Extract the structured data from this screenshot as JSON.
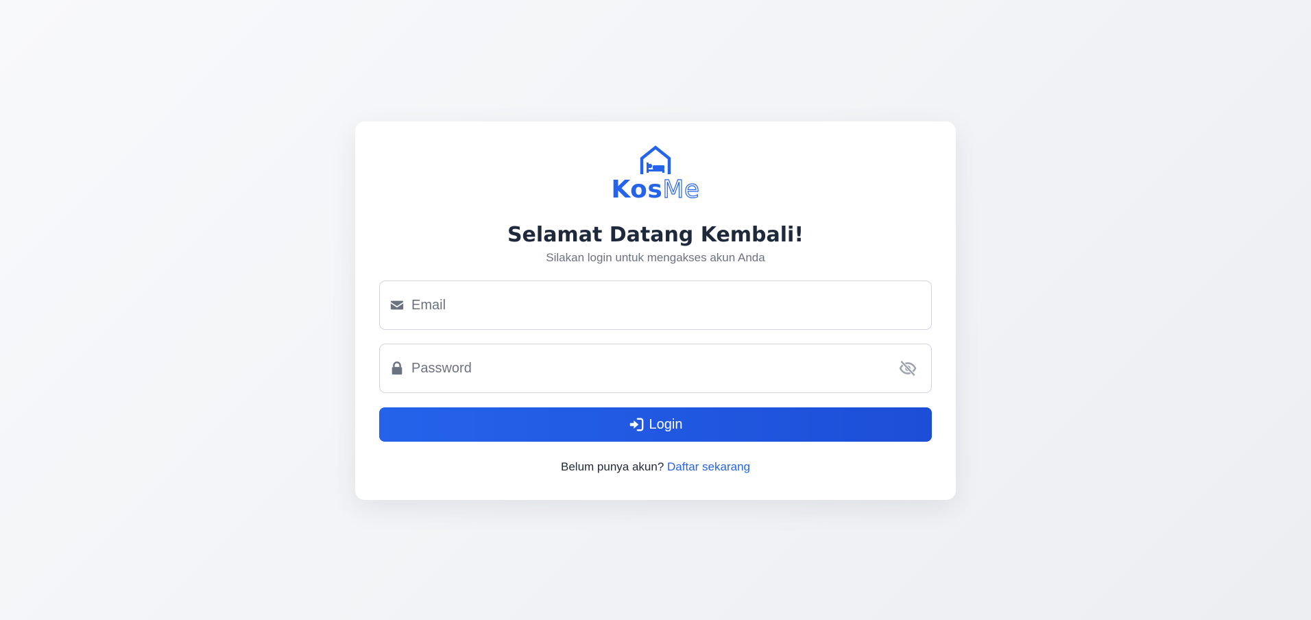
{
  "brand": {
    "part1": "Kos",
    "part2": "Me",
    "logo_icon": "house-bed-icon"
  },
  "heading": {
    "title": "Selamat Datang Kembali!",
    "subtitle": "Silakan login untuk mengakses akun Anda"
  },
  "form": {
    "email": {
      "icon": "envelope-icon",
      "value": "",
      "placeholder": "Email"
    },
    "password": {
      "icon": "lock-icon",
      "value": "",
      "placeholder": "Password",
      "toggle_icon": "eye-slash-icon"
    },
    "submit": {
      "icon": "sign-in-icon",
      "label": "Login"
    }
  },
  "footer": {
    "prompt": "Belum punya akun?",
    "link_label": "Daftar sekarang"
  },
  "colors": {
    "accent": "#2563eb",
    "title": "#1e293b",
    "muted": "#6b7280"
  }
}
